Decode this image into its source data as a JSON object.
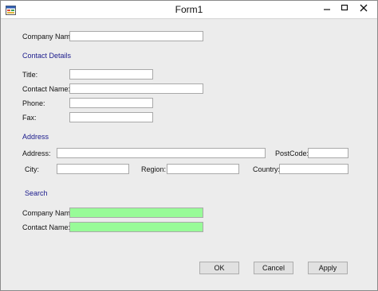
{
  "window": {
    "title": "Form1"
  },
  "form": {
    "company_name": {
      "label": "Company Name:",
      "value": ""
    },
    "contact_section": {
      "heading": "Contact Details",
      "title": {
        "label": "Title:",
        "value": ""
      },
      "contact_name": {
        "label": "Contact Name:",
        "value": ""
      },
      "phone": {
        "label": "Phone:",
        "value": ""
      },
      "fax": {
        "label": "Fax:",
        "value": ""
      }
    },
    "address_section": {
      "heading": "Address",
      "address": {
        "label": "Address:",
        "value": ""
      },
      "postcode": {
        "label": "PostCode:",
        "value": ""
      },
      "city": {
        "label": "City:",
        "value": ""
      },
      "region": {
        "label": "Region:",
        "value": ""
      },
      "country": {
        "label": "Country:",
        "value": ""
      }
    },
    "search_section": {
      "heading": "Search",
      "company_name": {
        "label": "Company Name:",
        "value": ""
      },
      "contact_name": {
        "label": "Contact Name:",
        "value": ""
      }
    }
  },
  "buttons": {
    "ok": "OK",
    "cancel": "Cancel",
    "apply": "Apply"
  },
  "colors": {
    "section_heading": "#1a1a8c",
    "search_field_background": "#98fb98",
    "form_background": "#ececec"
  },
  "icons": {
    "app": "form-app-icon",
    "minimize": "minimize-icon",
    "maximize": "maximize-icon",
    "close": "close-icon"
  }
}
